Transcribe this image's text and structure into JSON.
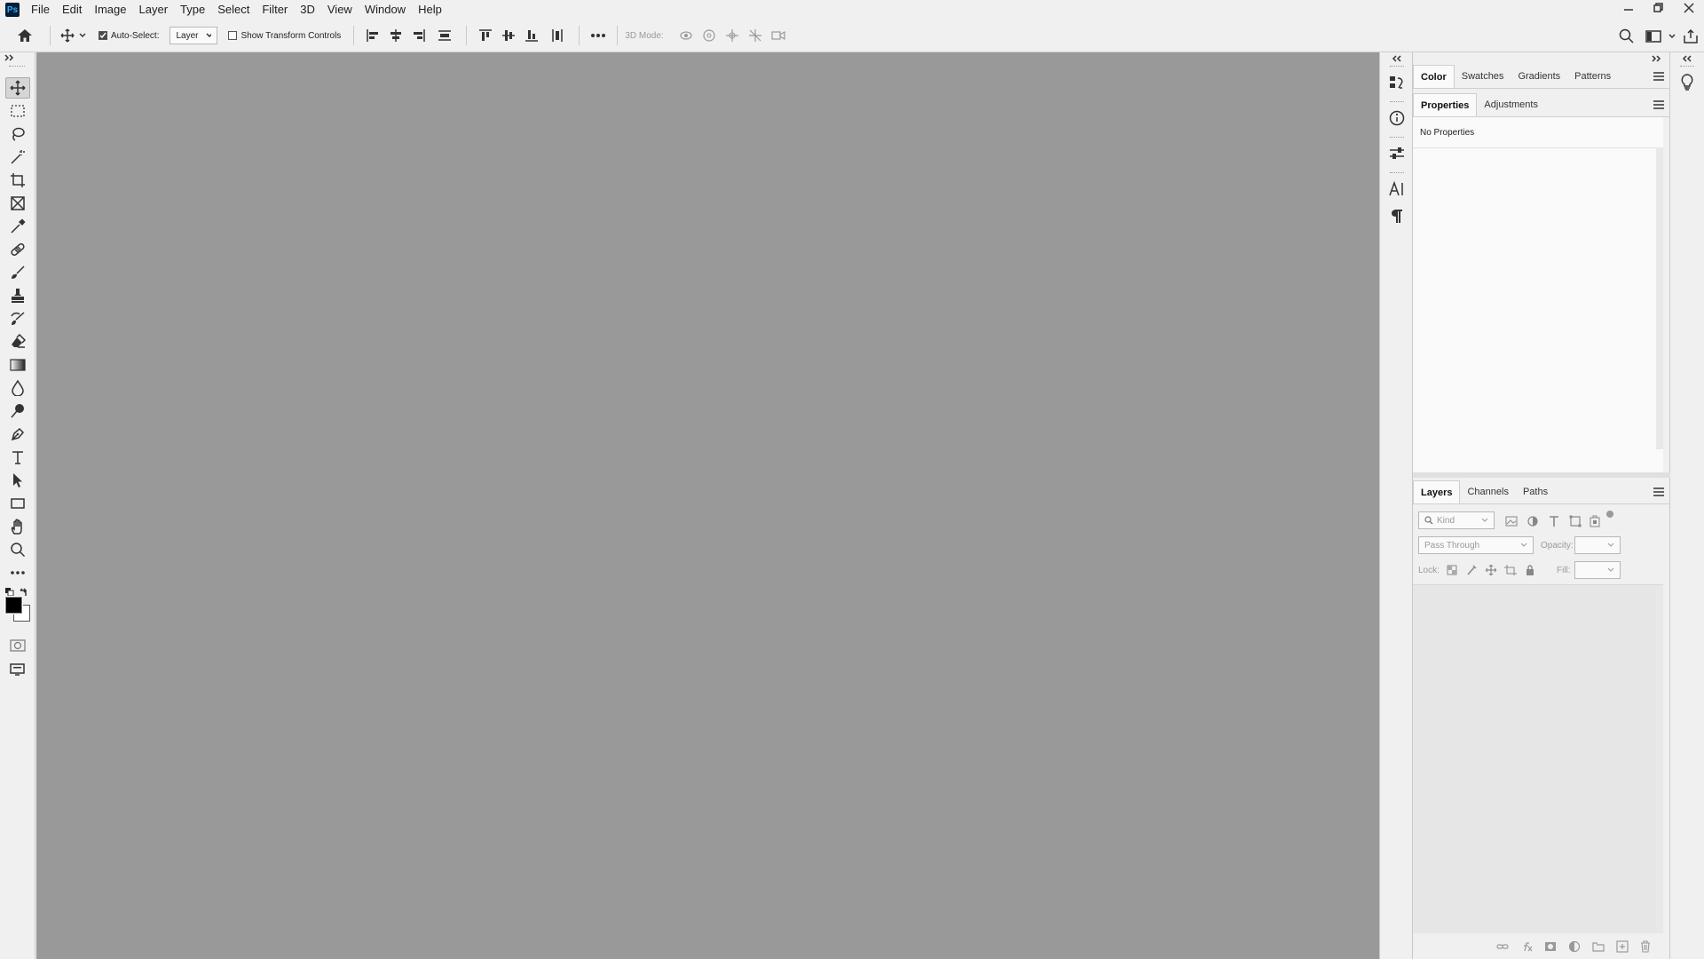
{
  "app": {
    "logo": "Ps"
  },
  "menu": [
    "File",
    "Edit",
    "Image",
    "Layer",
    "Type",
    "Select",
    "Filter",
    "3D",
    "View",
    "Window",
    "Help"
  ],
  "options": {
    "auto_select_label": "Auto-Select:",
    "auto_select_checked": true,
    "auto_select_target": "Layer",
    "show_transform_label": "Show Transform Controls",
    "show_transform_checked": false,
    "mode_3d_label": "3D Mode:"
  },
  "panels": {
    "top_tabs": [
      "Color",
      "Swatches",
      "Gradients",
      "Patterns"
    ],
    "mid_tabs": [
      "Properties",
      "Adjustments"
    ],
    "properties_empty": "No Properties",
    "layer_tabs": [
      "Layers",
      "Channels",
      "Paths"
    ],
    "filter_kind": "Kind",
    "blend_mode": "Pass Through",
    "opacity_label": "Opacity:",
    "lock_label": "Lock:",
    "fill_label": "Fill:"
  },
  "colors": {
    "canvas": "#999999",
    "foreground": "#000000",
    "background": "#ffffff"
  }
}
